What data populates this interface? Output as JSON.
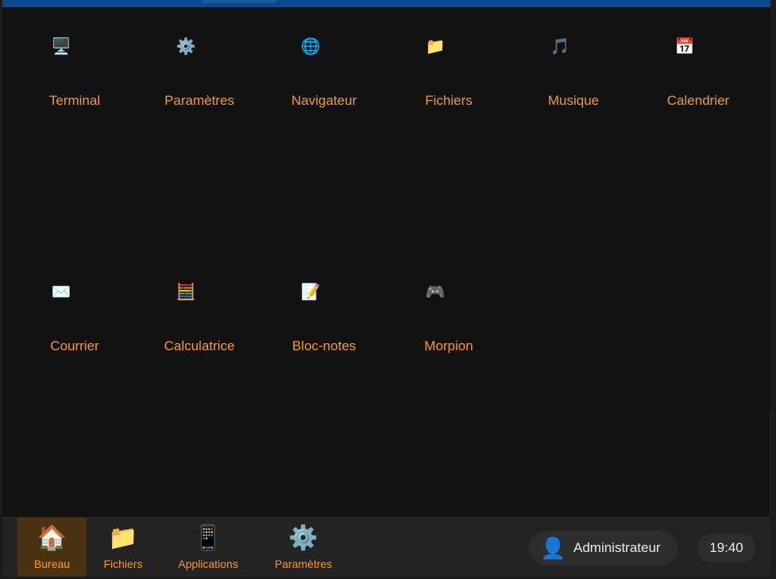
{
  "desktop": {
    "icons": [
      {
        "name": "terminal-icon",
        "glyph": "🖥️",
        "label": "Terminal"
      },
      {
        "name": "gear-icon",
        "glyph": "⚙️",
        "label": "Paramètres"
      },
      {
        "name": "globe-icon",
        "glyph": "🌐",
        "label": "Navigateur"
      },
      {
        "name": "folder-icon",
        "glyph": "📁",
        "label": "Fichiers"
      },
      {
        "name": "music-note-icon",
        "glyph": "🎵",
        "label": "Musique"
      },
      {
        "name": "calendar-icon",
        "glyph": "📅",
        "label": "Calendrier"
      },
      {
        "name": "envelope-icon",
        "glyph": "✉️",
        "label": "Courrier"
      },
      {
        "name": "abacus-icon",
        "glyph": "🧮",
        "label": "Calculatrice"
      },
      {
        "name": "memo-icon",
        "glyph": "📝",
        "label": "Bloc-notes"
      },
      {
        "name": "gamepad-icon",
        "glyph": "🎮",
        "label": "Morpion"
      }
    ]
  },
  "taskbar": {
    "items": [
      {
        "name": "house-icon",
        "glyph": "🏠",
        "label": "Bureau",
        "active": true
      },
      {
        "name": "folder-icon",
        "glyph": "📁",
        "label": "Fichiers",
        "active": false
      },
      {
        "name": "mobile-phone-icon",
        "glyph": "📱",
        "label": "Applications",
        "active": false
      },
      {
        "name": "gear-icon",
        "glyph": "⚙️",
        "label": "Paramètres",
        "active": false
      }
    ],
    "user": {
      "glyph": "👤",
      "name": "Administrateur"
    },
    "clock": "19:40"
  },
  "colors": {
    "accent": "#f49a2b",
    "background": "#121212",
    "taskbar": "#232323",
    "topbar": "#0d4a8d",
    "active_task": "#4a3212"
  }
}
